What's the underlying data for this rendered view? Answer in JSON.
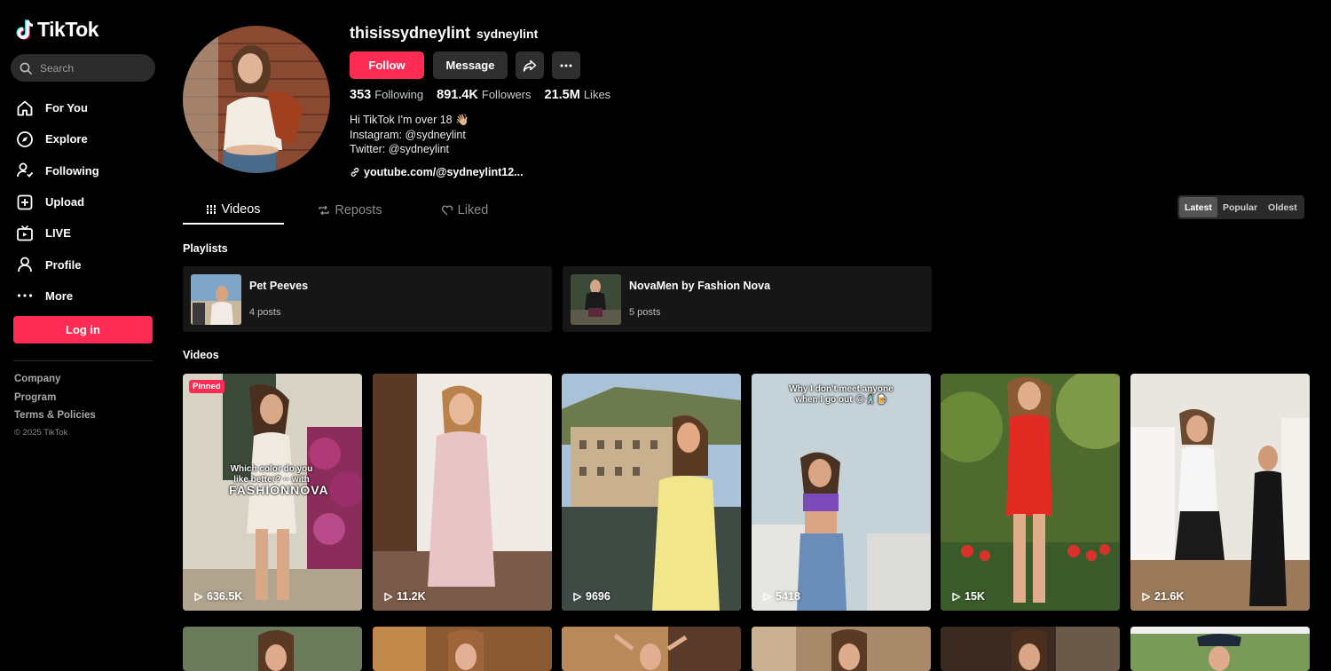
{
  "brand": {
    "name": "TikTok"
  },
  "search": {
    "placeholder": "Search"
  },
  "nav": [
    {
      "label": "For You",
      "icon": "home-icon"
    },
    {
      "label": "Explore",
      "icon": "compass-icon"
    },
    {
      "label": "Following",
      "icon": "user-follow-icon"
    },
    {
      "label": "Upload",
      "icon": "upload-icon"
    },
    {
      "label": "LIVE",
      "icon": "live-tv-icon"
    },
    {
      "label": "Profile",
      "icon": "person-icon"
    },
    {
      "label": "More",
      "icon": "more-dots-icon"
    }
  ],
  "login_label": "Log in",
  "footer": {
    "company": "Company",
    "program": "Program",
    "terms": "Terms & Policies",
    "copyright": "© 2025 TikTok"
  },
  "profile": {
    "username": "thisissydneylint",
    "nickname": "sydneylint",
    "follow_label": "Follow",
    "message_label": "Message",
    "stats": {
      "following_count": "353",
      "following_label": "Following",
      "followers_count": "891.4K",
      "followers_label": "Followers",
      "likes_count": "21.5M",
      "likes_label": "Likes"
    },
    "bio": [
      "Hi TikTok I'm over 18 👋🏼",
      "Instagram: @sydneylint",
      "Twitter: @sydneylint"
    ],
    "link": "youtube.com/@sydneylint12..."
  },
  "tabs": {
    "videos": "Videos",
    "reposts": "Reposts",
    "liked": "Liked"
  },
  "sort": {
    "latest": "Latest",
    "popular": "Popular",
    "oldest": "Oldest"
  },
  "sections": {
    "playlists": "Playlists",
    "videos": "Videos"
  },
  "playlists": [
    {
      "name": "Pet Peeves",
      "count": "4 posts"
    },
    {
      "name": "NovaMen by Fashion Nova",
      "count": "5 posts"
    }
  ],
  "videos": [
    {
      "views": "636.5K",
      "pinned": "Pinned",
      "caption": "Which color do you like better? ·· with",
      "brand": "FASHIONNOVA"
    },
    {
      "views": "11.2K"
    },
    {
      "views": "9696"
    },
    {
      "views": "5418",
      "caption": "Why I don't meet anyone when I go out 😂🕺🍺"
    },
    {
      "views": "15K"
    },
    {
      "views": "21.6K"
    }
  ],
  "colors": {
    "accent": "#fe2c55",
    "background": "#000000",
    "surface": "#161616"
  }
}
